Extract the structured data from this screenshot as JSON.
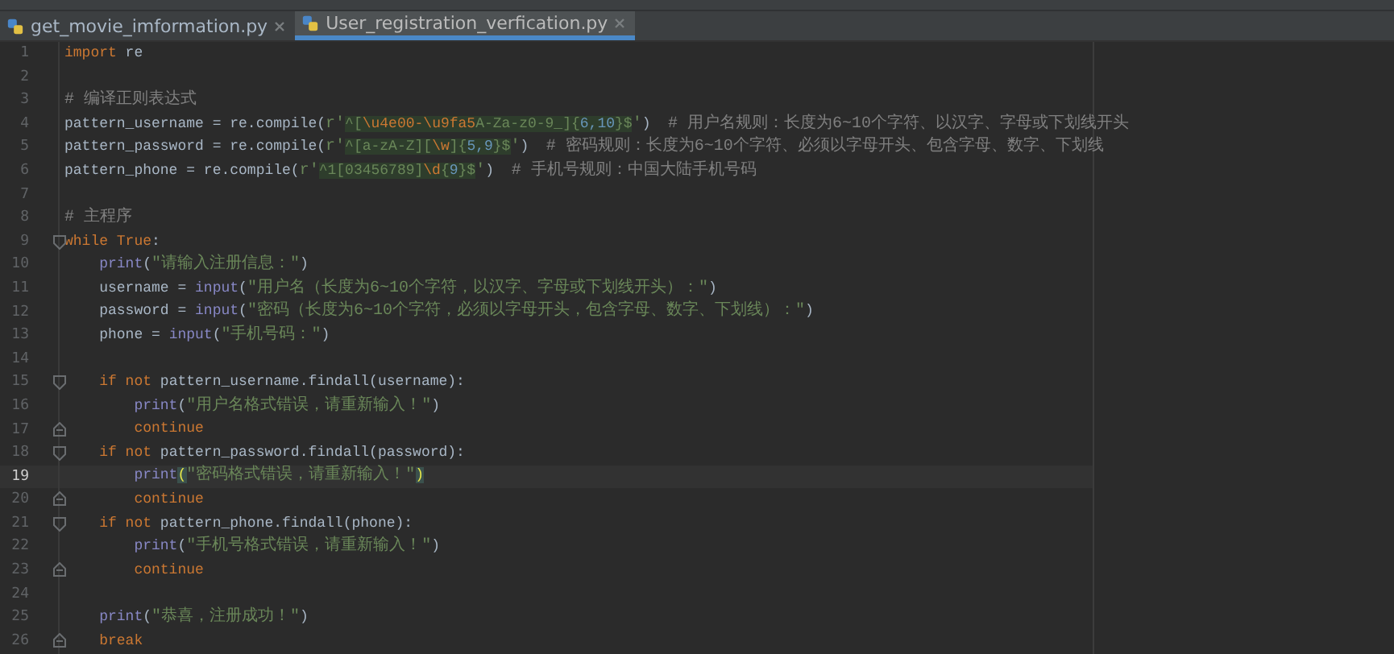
{
  "tabs": [
    {
      "label": "get_movie_imformation.py",
      "selected": false
    },
    {
      "label": "User_registration_verfication.py",
      "selected": true
    }
  ],
  "editor": {
    "lines": [
      {
        "number": "1",
        "kind": "plain",
        "current": false,
        "tokens": [
          {
            "kind": "kw",
            "t": "import"
          },
          {
            "kind": "id",
            "t": " re"
          }
        ]
      },
      {
        "number": "2",
        "kind": "plain",
        "current": false
      },
      {
        "number": "3",
        "kind": "plain",
        "current": false,
        "tokens": [
          {
            "kind": "cm",
            "t": "# 编译正则表达式"
          }
        ]
      },
      {
        "number": "4",
        "kind": "plain",
        "current": false,
        "tokens": [
          {
            "kind": "id",
            "t": "pattern_username = re.compile("
          },
          {
            "kind": "str",
            "t": "r'"
          },
          {
            "kind": "re",
            "t": "^["
          },
          {
            "kind": "rb",
            "t": "\\u4e00-\\u9fa5"
          },
          {
            "kind": "re",
            "t": "A-Za-z0-9_]{"
          },
          {
            "kind": "rn",
            "t": "6,10"
          },
          {
            "kind": "re",
            "t": "}$"
          },
          {
            "kind": "str",
            "t": "'"
          },
          {
            "kind": "id",
            "t": ")  "
          },
          {
            "kind": "cm",
            "t": "# 用户名规则：长度为6~10个字符、以汉字、字母或下划线开头"
          }
        ]
      },
      {
        "number": "5",
        "kind": "plain",
        "current": false,
        "tokens": [
          {
            "kind": "id",
            "t": "pattern_password = re.compile("
          },
          {
            "kind": "str",
            "t": "r'"
          },
          {
            "kind": "re",
            "t": "^[a-zA-Z]["
          },
          {
            "kind": "rb",
            "t": "\\w"
          },
          {
            "kind": "re",
            "t": "]{"
          },
          {
            "kind": "rn",
            "t": "5,9"
          },
          {
            "kind": "re",
            "t": "}$"
          },
          {
            "kind": "str",
            "t": "'"
          },
          {
            "kind": "id",
            "t": ")  "
          },
          {
            "kind": "cm",
            "t": "# 密码规则：长度为6~10个字符、必须以字母开头、包含字母、数字、下划线"
          }
        ]
      },
      {
        "number": "6",
        "kind": "plain",
        "current": false,
        "tokens": [
          {
            "kind": "id",
            "t": "pattern_phone = re.compile("
          },
          {
            "kind": "str",
            "t": "r'"
          },
          {
            "kind": "re",
            "t": "^1[03456789]"
          },
          {
            "kind": "rb",
            "t": "\\d"
          },
          {
            "kind": "re",
            "t": "{"
          },
          {
            "kind": "rn",
            "t": "9"
          },
          {
            "kind": "re",
            "t": "}$"
          },
          {
            "kind": "str",
            "t": "'"
          },
          {
            "kind": "id",
            "t": ")  "
          },
          {
            "kind": "cm",
            "t": "# 手机号规则：中国大陆手机号码"
          }
        ]
      },
      {
        "number": "7",
        "kind": "plain",
        "current": false
      },
      {
        "number": "8",
        "kind": "plain",
        "current": false,
        "tokens": [
          {
            "kind": "cm",
            "t": "# 主程序"
          }
        ]
      },
      {
        "number": "9",
        "kind": "fold-start",
        "current": false,
        "tokens": [
          {
            "kind": "kw",
            "t": "while True"
          },
          {
            "kind": "id",
            "t": ":"
          }
        ]
      },
      {
        "number": "10",
        "kind": "plain",
        "current": false,
        "tokens": [
          {
            "kind": "bi",
            "t": "    print"
          },
          {
            "kind": "id",
            "t": "("
          },
          {
            "kind": "str",
            "t": "\"请输入注册信息：\""
          },
          {
            "kind": "id",
            "t": ")"
          }
        ]
      },
      {
        "number": "11",
        "kind": "plain",
        "current": false,
        "tokens": [
          {
            "kind": "id",
            "t": "    username = "
          },
          {
            "kind": "bi",
            "t": "input"
          },
          {
            "kind": "id",
            "t": "("
          },
          {
            "kind": "str",
            "t": "\"用户名（长度为6~10个字符，以汉字、字母或下划线开头）：\""
          },
          {
            "kind": "id",
            "t": ")"
          }
        ]
      },
      {
        "number": "12",
        "kind": "plain",
        "current": false,
        "tokens": [
          {
            "kind": "id",
            "t": "    password = "
          },
          {
            "kind": "bi",
            "t": "input"
          },
          {
            "kind": "id",
            "t": "("
          },
          {
            "kind": "str",
            "t": "\"密码（长度为6~10个字符，必须以字母开头，包含字母、数字、下划线）：\""
          },
          {
            "kind": "id",
            "t": ")"
          }
        ]
      },
      {
        "number": "13",
        "kind": "plain",
        "current": false,
        "tokens": [
          {
            "kind": "id",
            "t": "    phone = "
          },
          {
            "kind": "bi",
            "t": "input"
          },
          {
            "kind": "id",
            "t": "("
          },
          {
            "kind": "str",
            "t": "\"手机号码：\""
          },
          {
            "kind": "id",
            "t": ")"
          }
        ]
      },
      {
        "number": "14",
        "kind": "plain",
        "current": false
      },
      {
        "number": "15",
        "kind": "fold-start",
        "current": false,
        "tokens": [
          {
            "kind": "kw",
            "t": "    if not"
          },
          {
            "kind": "id",
            "t": " pattern_username.findall(username):"
          }
        ]
      },
      {
        "number": "16",
        "kind": "plain",
        "current": false,
        "tokens": [
          {
            "kind": "bi",
            "t": "        print"
          },
          {
            "kind": "id",
            "t": "("
          },
          {
            "kind": "str",
            "t": "\"用户名格式错误，请重新输入！\""
          },
          {
            "kind": "id",
            "t": ")"
          }
        ]
      },
      {
        "number": "17",
        "kind": "fold-end",
        "current": false,
        "tokens": [
          {
            "kind": "kw",
            "t": "        continue"
          }
        ]
      },
      {
        "number": "18",
        "kind": "fold-start",
        "current": false,
        "tokens": [
          {
            "kind": "kw",
            "t": "    if not"
          },
          {
            "kind": "id",
            "t": " pattern_password.findall(password):"
          }
        ]
      },
      {
        "number": "19",
        "kind": "plain",
        "current": true,
        "tokens": [
          {
            "kind": "bi",
            "t": "        print"
          },
          {
            "kind": "pm",
            "t": "("
          },
          {
            "kind": "str",
            "t": "\"密码格式错误，请重新输入！\""
          },
          {
            "kind": "pm",
            "t": ")"
          }
        ]
      },
      {
        "number": "20",
        "kind": "fold-end",
        "current": false,
        "tokens": [
          {
            "kind": "kw",
            "t": "        continue"
          }
        ]
      },
      {
        "number": "21",
        "kind": "fold-start",
        "current": false,
        "tokens": [
          {
            "kind": "kw",
            "t": "    if not"
          },
          {
            "kind": "id",
            "t": " pattern_phone.findall(phone):"
          }
        ]
      },
      {
        "number": "22",
        "kind": "plain",
        "current": false,
        "tokens": [
          {
            "kind": "bi",
            "t": "        print"
          },
          {
            "kind": "id",
            "t": "("
          },
          {
            "kind": "str",
            "t": "\"手机号格式错误，请重新输入！\""
          },
          {
            "kind": "id",
            "t": ")"
          }
        ]
      },
      {
        "number": "23",
        "kind": "fold-end",
        "current": false,
        "tokens": [
          {
            "kind": "kw",
            "t": "        continue"
          }
        ]
      },
      {
        "number": "24",
        "kind": "plain",
        "current": false
      },
      {
        "number": "25",
        "kind": "plain",
        "current": false,
        "tokens": [
          {
            "kind": "bi",
            "t": "    print"
          },
          {
            "kind": "id",
            "t": "("
          },
          {
            "kind": "str",
            "t": "\"恭喜，注册成功！\""
          },
          {
            "kind": "id",
            "t": ")"
          }
        ]
      },
      {
        "number": "26",
        "kind": "fold-end",
        "current": false,
        "tokens": [
          {
            "kind": "kw",
            "t": "    break"
          }
        ]
      }
    ]
  }
}
